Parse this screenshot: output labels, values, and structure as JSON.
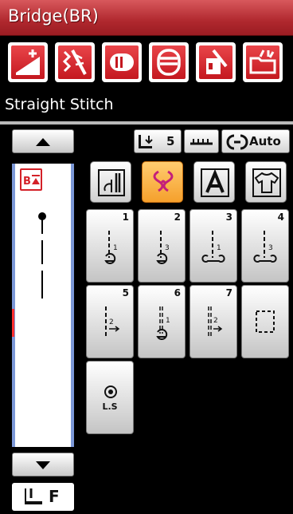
{
  "title": "Bridge(BR)",
  "stitch_name": "Straight Stitch",
  "toolbar": {
    "buttons": [
      {
        "name": "tension-up-icon"
      },
      {
        "name": "sequence-icon"
      },
      {
        "name": "memory-icon"
      },
      {
        "name": "list-icon"
      },
      {
        "name": "delete-icon"
      },
      {
        "name": "open-folder-icon"
      }
    ]
  },
  "status": {
    "feed_value": "5",
    "auto_label": "Auto"
  },
  "stitches": [
    {
      "num": "1"
    },
    {
      "num": "2"
    },
    {
      "num": "3"
    },
    {
      "num": "4"
    },
    {
      "num": "5"
    },
    {
      "num": "6"
    },
    {
      "num": "7"
    },
    {
      "num": ""
    }
  ],
  "ls_label": "L.S",
  "categories": [
    {
      "name": "utility-stitch-icon"
    },
    {
      "name": "decorative-stitch-icon"
    },
    {
      "name": "alphabet-icon"
    },
    {
      "name": "shirt-icon"
    }
  ],
  "footer": {
    "foot_letter": "F"
  },
  "colors": {
    "title_bar": "#b0282e",
    "tool_button": "#d42128",
    "selected_category": "#f5a02c",
    "panel_border": "#7c98d8"
  }
}
